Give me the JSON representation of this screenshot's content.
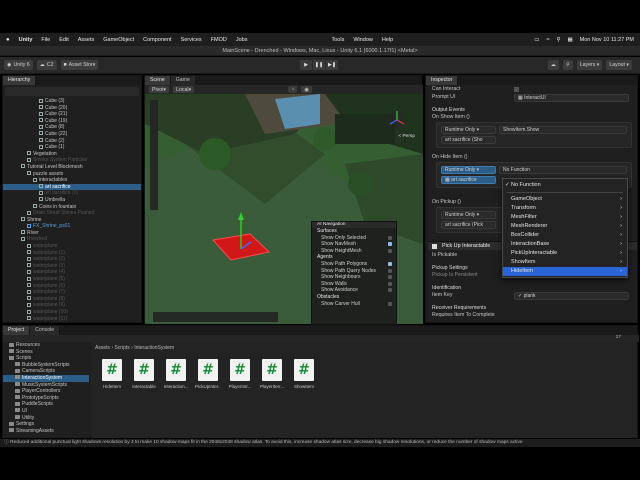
{
  "menubar": {
    "items": [
      "Unity",
      "File",
      "Edit",
      "Assets",
      "GameObject",
      "Component",
      "Services",
      "FMOD",
      "Jobs"
    ],
    "right": [
      "Tools",
      "Window",
      "Help"
    ],
    "clock": "Mon Nov 10  11:27 PM"
  },
  "window": {
    "title": "MainScene - Drenched - Windows, Mac, Linux - Unity 6.1 (6000.1.17f1) <Metal>"
  },
  "toolbar": {
    "account": "Unity 6",
    "cloud": "C2",
    "asset_store": "Asset Store",
    "layers": "Layers",
    "layout": "Layout"
  },
  "hierarchy": {
    "tab": "Hierarchy",
    "rows": [
      {
        "label": "Cube (3)",
        "indent": 6,
        "state": "normal"
      },
      {
        "label": "Cube (20)",
        "indent": 6,
        "state": "normal"
      },
      {
        "label": "Cube (21)",
        "indent": 6,
        "state": "normal"
      },
      {
        "label": "Cube (19)",
        "indent": 6,
        "state": "normal"
      },
      {
        "label": "Cube (8)",
        "indent": 6,
        "state": "normal"
      },
      {
        "label": "Cube (22)",
        "indent": 6,
        "state": "normal"
      },
      {
        "label": "Cube (2)",
        "indent": 6,
        "state": "normal"
      },
      {
        "label": "Cube (1)",
        "indent": 6,
        "state": "normal"
      },
      {
        "label": "Vegetation",
        "indent": 4,
        "state": "normal"
      },
      {
        "label": "Smoke System Particles",
        "indent": 4,
        "state": "dim"
      },
      {
        "label": "Tutorial Level Blockmesh",
        "indent": 3,
        "state": "normal"
      },
      {
        "label": "puzzle assets",
        "indent": 4,
        "state": "normal"
      },
      {
        "label": "interactables",
        "indent": 5,
        "state": "normal"
      },
      {
        "label": "art sacrifice",
        "indent": 6,
        "state": "sel"
      },
      {
        "label": "art sacrifice (1)",
        "indent": 6,
        "state": "dim"
      },
      {
        "label": "Umbrella",
        "indent": 6,
        "state": "normal"
      },
      {
        "label": "Coins in fountain",
        "indent": 5,
        "state": "normal"
      },
      {
        "label": "Drain Shrub Slimes Pushed",
        "indent": 4,
        "state": "dim"
      },
      {
        "label": "Shrine",
        "indent": 3,
        "state": "normal"
      },
      {
        "label": "FX_Shrine_ps01",
        "indent": 4,
        "state": "blue"
      },
      {
        "label": "River",
        "indent": 3,
        "state": "normal"
      },
      {
        "label": "Riverbed",
        "indent": 3,
        "state": "dim"
      },
      {
        "label": "waterplane",
        "indent": 4,
        "state": "dim"
      },
      {
        "label": "waterplane (1)",
        "indent": 4,
        "state": "dim"
      },
      {
        "label": "waterplane (2)",
        "indent": 4,
        "state": "dim"
      },
      {
        "label": "waterplane (3)",
        "indent": 4,
        "state": "dim"
      },
      {
        "label": "waterplane (4)",
        "indent": 4,
        "state": "dim"
      },
      {
        "label": "waterplane (5)",
        "indent": 4,
        "state": "dim"
      },
      {
        "label": "waterplane (6)",
        "indent": 4,
        "state": "dim"
      },
      {
        "label": "waterplane (7)",
        "indent": 4,
        "state": "dim"
      },
      {
        "label": "waterplane (8)",
        "indent": 4,
        "state": "dim"
      },
      {
        "label": "waterplane (9)",
        "indent": 4,
        "state": "dim"
      },
      {
        "label": "waterplane (10)",
        "indent": 4,
        "state": "dim"
      },
      {
        "label": "waterplane (11)",
        "indent": 4,
        "state": "dim"
      }
    ]
  },
  "scene": {
    "tabs": [
      "Scene",
      "Game"
    ],
    "pivot": "Pivot",
    "local": "Local",
    "persp": "< Persp",
    "nav_overlay": {
      "title": "AI Navigation",
      "rows": [
        {
          "label": "Surfaces",
          "type": "hdr",
          "checked": false
        },
        {
          "label": "Show Only Selected",
          "type": "item",
          "checked": false
        },
        {
          "label": "Show NavMesh",
          "type": "item",
          "checked": true
        },
        {
          "label": "Show HeightMesh",
          "type": "item",
          "checked": false
        },
        {
          "label": "Agents",
          "type": "hdr",
          "checked": false
        },
        {
          "label": "Show Path Polygons",
          "type": "item",
          "checked": true
        },
        {
          "label": "Show Path Query Nodes",
          "type": "item",
          "checked": false
        },
        {
          "label": "Show Neighbours",
          "type": "item",
          "checked": false
        },
        {
          "label": "Show Walls",
          "type": "item",
          "checked": false
        },
        {
          "label": "Show Avoidance",
          "type": "item",
          "checked": false
        },
        {
          "label": "Obstacles",
          "type": "hdr",
          "checked": false
        },
        {
          "label": "Show Carver Hull",
          "type": "item",
          "checked": false
        }
      ]
    }
  },
  "inspector": {
    "tab": "Inspector",
    "can_interact": "Can Interact",
    "prompt_ui": "Prompt UI",
    "prompt_ui_value": "InteractUI",
    "output_events": "Output Events",
    "on_show_item": "On Show Item ()",
    "runtime_only": "Runtime Only",
    "show_fn": "ShowItem.Show",
    "art_obj": "art sacrifice (Sho",
    "on_hide_item": "On Hide Item ()",
    "no_function": "No Function",
    "art_obj2": "art sacrifice",
    "on_pickup": "On Pickup ()",
    "art_obj3": "art sacrifice (Pick",
    "component": "Pick Up Interactable",
    "is_pickable": "Is Pickable",
    "pickup_settings": "Pickup Settings",
    "pickup_sub": "Pickup Is Persistent",
    "identification": "Identification",
    "item_key": "Item Key",
    "item_key_value": "plank",
    "receiver": "Receiver Requirements",
    "requires": "Requires Item To Complete"
  },
  "dropdown": {
    "selected": "No Function",
    "items": [
      "GameObject",
      "Transform",
      "MeshFilter",
      "MeshRenderer",
      "BoxCollider",
      "InteractionBase",
      "PickUpInteractable",
      "ShowItem",
      "HideItem"
    ],
    "highlighted": "HideItem"
  },
  "project": {
    "tabs": [
      "Project",
      "Console"
    ],
    "tree": [
      {
        "label": "Resources",
        "indent": 1,
        "sel": false
      },
      {
        "label": "Scenes",
        "indent": 1,
        "sel": false
      },
      {
        "label": "Scripts",
        "indent": 1,
        "sel": false
      },
      {
        "label": "BubbleSystemScripts",
        "indent": 2,
        "sel": false
      },
      {
        "label": "CameraScripts",
        "indent": 2,
        "sel": false
      },
      {
        "label": "InteractionSystem",
        "indent": 2,
        "sel": true
      },
      {
        "label": "MusicSystemScripts",
        "indent": 2,
        "sel": false
      },
      {
        "label": "PlayerControllers",
        "indent": 2,
        "sel": false
      },
      {
        "label": "PrototypeScripts",
        "indent": 2,
        "sel": false
      },
      {
        "label": "PuddleScripts",
        "indent": 2,
        "sel": false
      },
      {
        "label": "UI",
        "indent": 2,
        "sel": false
      },
      {
        "label": "Utility",
        "indent": 2,
        "sel": false
      },
      {
        "label": "Settings",
        "indent": 1,
        "sel": false
      },
      {
        "label": "StreamingAssets",
        "indent": 1,
        "sel": false
      }
    ],
    "breadcrumb": [
      "Assets",
      "Scripts",
      "InteractionSystem"
    ],
    "assets": [
      "HideItem",
      "Interactable",
      "Interaction...",
      "PickUpInter...",
      "PlayerIntr...",
      "PlayerIterr...",
      "ShowItem"
    ],
    "count": "27"
  },
  "status": "Reduced additional punctual light shadows resolution by 2 to make 10 shadow maps fit in the 2048x2048 shadow atlas. To avoid this, increase shadow atlas size, decrease big shadow resolutions, or reduce the number of shadow maps active"
}
